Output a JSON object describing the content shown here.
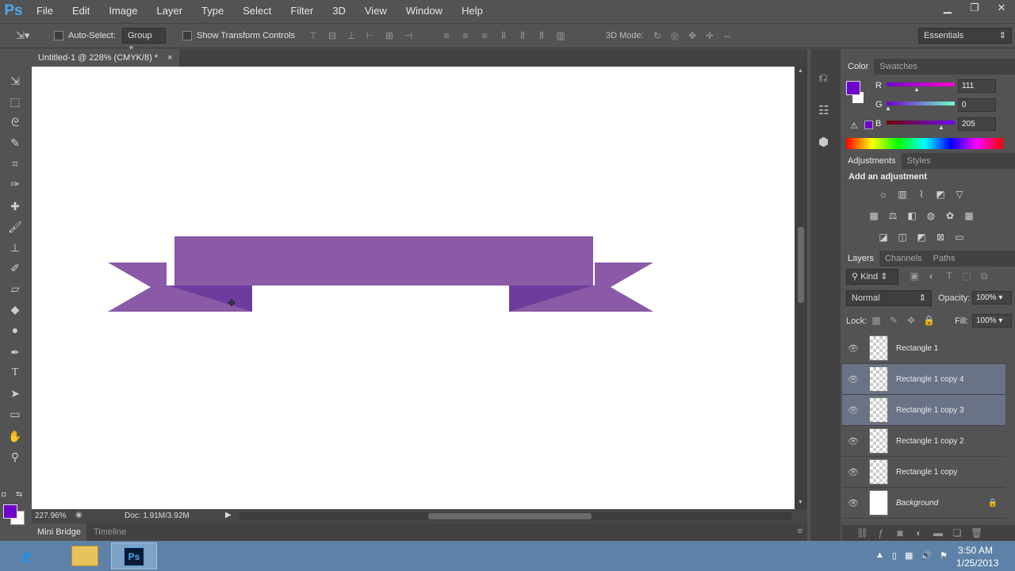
{
  "app": {
    "logo": "Ps"
  },
  "menu": [
    "File",
    "Edit",
    "Image",
    "Layer",
    "Type",
    "Select",
    "Filter",
    "3D",
    "View",
    "Window",
    "Help"
  ],
  "window_controls": [
    "minimize-icon",
    "restore-icon",
    "close-icon"
  ],
  "options": {
    "auto_select_label": "Auto-Select:",
    "group_value": "Group",
    "show_transform_label": "Show Transform Controls",
    "mode_3d_label": "3D Mode:",
    "workspace": "Essentials"
  },
  "document": {
    "tab_title": "Untitled-1 @ 228% (CMYK/8) *",
    "close": "×",
    "ribbon_color": "#8a5aa6",
    "fold_color": "#6d3d9e"
  },
  "status": {
    "zoom": "227.96%",
    "doc": "Doc: 1.91M/3.92M"
  },
  "bottom_tabs": [
    "Mini Bridge",
    "Timeline"
  ],
  "color_panel": {
    "tabs": [
      "Color",
      "Swatches"
    ],
    "foreground": "#6f00cd",
    "channels": [
      {
        "label": "R",
        "value": "111"
      },
      {
        "label": "G",
        "value": "0"
      },
      {
        "label": "B",
        "value": "205"
      }
    ]
  },
  "adjustments": {
    "tabs": [
      "Adjustments",
      "Styles"
    ],
    "heading": "Add an adjustment"
  },
  "layers": {
    "tabs": [
      "Layers",
      "Channels",
      "Paths"
    ],
    "kind": "Kind",
    "blend_mode": "Normal",
    "opacity_label": "Opacity:",
    "opacity": "100%",
    "lock_label": "Lock:",
    "fill_label": "Fill:",
    "fill": "100%",
    "items": [
      {
        "name": "Rectangle 1",
        "selected": false
      },
      {
        "name": "Rectangle 1 copy 4",
        "selected": true
      },
      {
        "name": "Rectangle 1 copy 3",
        "selected": true
      },
      {
        "name": "Rectangle 1 copy 2",
        "selected": false
      },
      {
        "name": "Rectangle 1 copy",
        "selected": false
      },
      {
        "name": "Background",
        "selected": false
      }
    ]
  },
  "taskbar": {
    "time": "3:50 AM",
    "date": "1/25/2013"
  }
}
